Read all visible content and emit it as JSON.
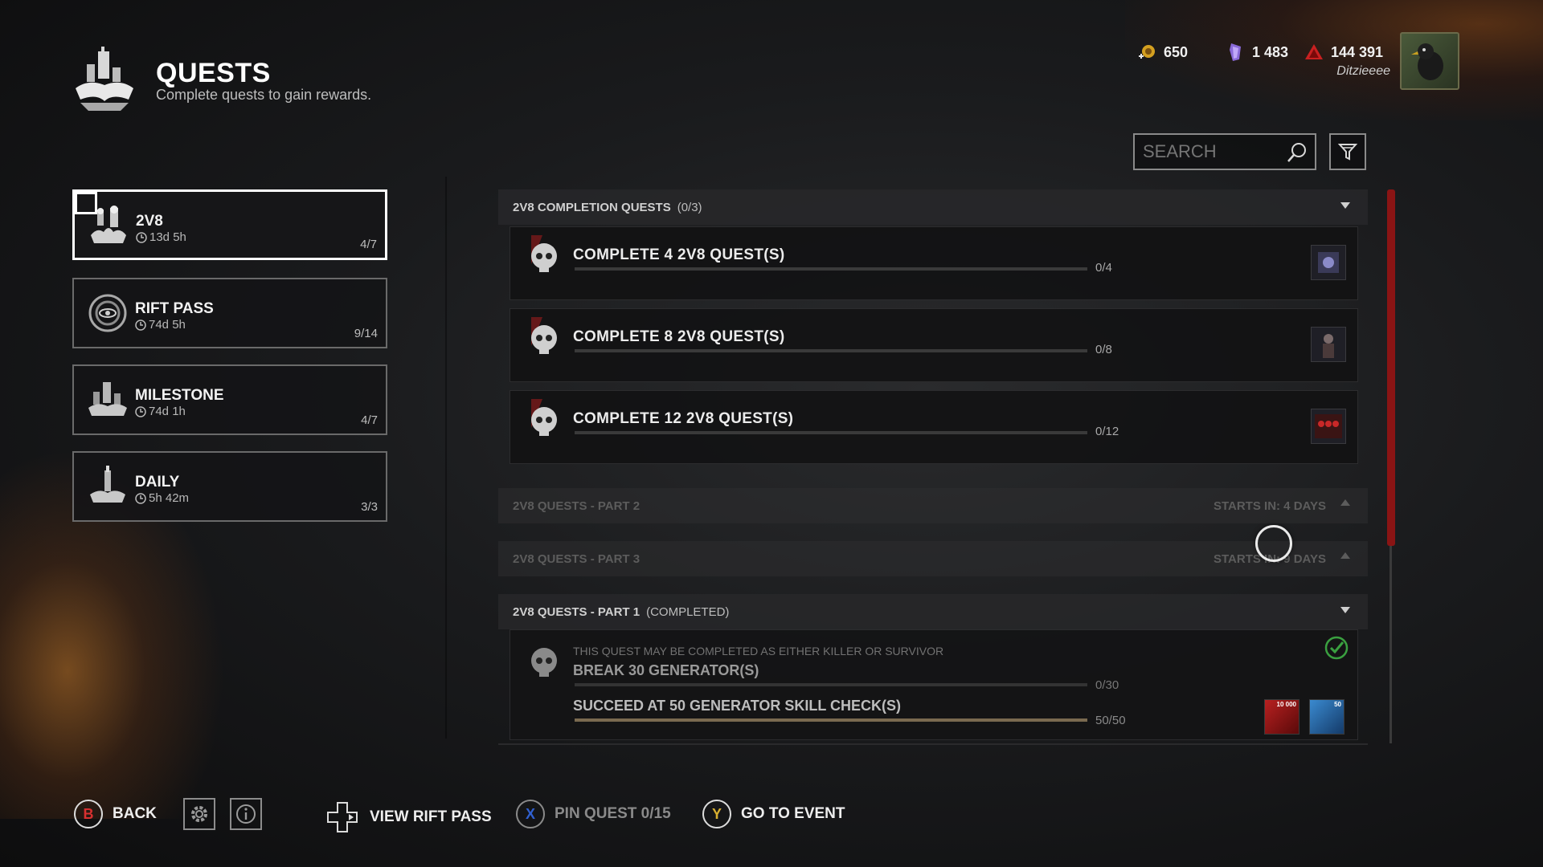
{
  "header": {
    "title": "QUESTS",
    "subtitle": "Complete quests to gain rewards."
  },
  "currencies": [
    {
      "name": "iridescent-shards",
      "value": "650",
      "color": "#d4a020"
    },
    {
      "name": "auric-cells",
      "value": "1 483",
      "color": "#8a6ad8"
    },
    {
      "name": "bloodpoints",
      "value": "144 391",
      "color": "#c82020"
    }
  ],
  "user": {
    "name": "Ditzieeee"
  },
  "search": {
    "placeholder": "SEARCH"
  },
  "categories": [
    {
      "name": "2V8",
      "time": "13d 5h",
      "progress": "4/7",
      "active": true
    },
    {
      "name": "RIFT PASS",
      "time": "74d 5h",
      "progress": "9/14",
      "active": false
    },
    {
      "name": "MILESTONE",
      "time": "74d 1h",
      "progress": "4/7",
      "active": false
    },
    {
      "name": "DAILY",
      "time": "5h 42m",
      "progress": "3/3",
      "active": false
    }
  ],
  "sections": {
    "completion": {
      "title": "2V8 COMPLETION QUESTS",
      "count": "(0/3)"
    },
    "part2": {
      "title": "2V8 QUESTS - PART 2",
      "status": "STARTS IN: 4 DAYS"
    },
    "part3": {
      "title": "2V8 QUESTS - PART 3",
      "status": "STARTS IN: 9 DAYS"
    },
    "part1": {
      "title": "2V8 QUESTS - PART 1",
      "status": "(COMPLETED)"
    }
  },
  "quests": [
    {
      "title": "COMPLETE 4 2V8 QUEST(S)",
      "progress": "0/4",
      "fraction": 0
    },
    {
      "title": "COMPLETE 8 2V8 QUEST(S)",
      "progress": "0/8",
      "fraction": 0
    },
    {
      "title": "COMPLETE 12 2V8 QUEST(S)",
      "progress": "0/12",
      "fraction": 0
    }
  ],
  "completed_quest": {
    "note": "THIS QUEST MAY BE COMPLETED AS EITHER KILLER OR SURVIVOR",
    "task1": {
      "title": "BREAK 30 GENERATOR(S)",
      "progress": "0/30"
    },
    "task2": {
      "title": "SUCCEED AT 50 GENERATOR SKILL CHECK(S)",
      "progress": "50/50"
    },
    "reward_bp": "10 000",
    "reward_xp": "50"
  },
  "actions": {
    "back": {
      "key": "B",
      "label": "BACK"
    },
    "rift": {
      "label": "VIEW RIFT PASS"
    },
    "pin": {
      "key": "X",
      "label": "PIN QUEST 0/15"
    },
    "event": {
      "key": "Y",
      "label": "GO TO EVENT"
    }
  },
  "colors": {
    "accent_red": "#8a1414",
    "key_b": "#d83030",
    "key_x": "#3060d0",
    "key_y": "#d8b030"
  }
}
